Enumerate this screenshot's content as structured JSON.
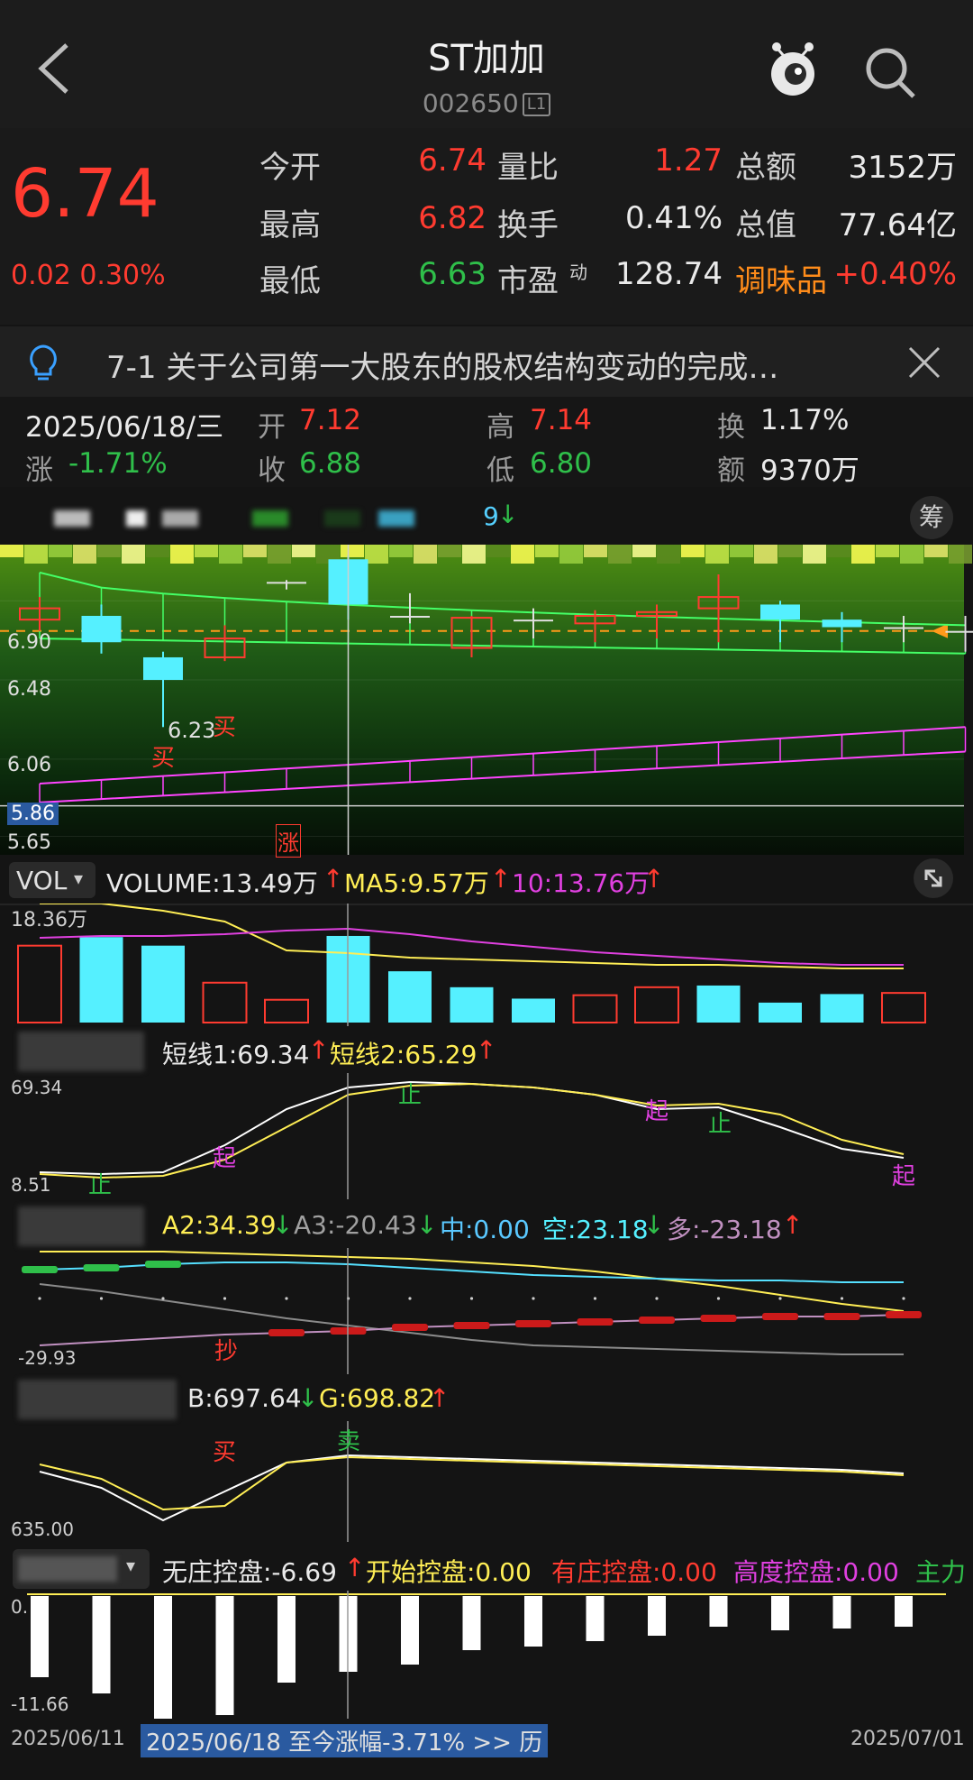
{
  "header": {
    "title": "ST加加",
    "code": "002650",
    "level_badge": "L1"
  },
  "quote": {
    "price": "6.74",
    "change": "0.02",
    "change_pct": "0.30%",
    "fields": [
      {
        "label": "今开",
        "value": "6.74",
        "color": "red"
      },
      {
        "label": "量比",
        "value": "1.27",
        "color": "red"
      },
      {
        "label": "总额",
        "value": "3152万",
        "color": "white"
      },
      {
        "label": "最高",
        "value": "6.82",
        "color": "red"
      },
      {
        "label": "换手",
        "value": "0.41%",
        "color": "white"
      },
      {
        "label": "总值",
        "value": "77.64亿",
        "color": "white"
      },
      {
        "label": "最低",
        "value": "6.63",
        "color": "green"
      },
      {
        "label": "市盈",
        "value": "128.74",
        "color": "white"
      },
      {
        "label": "调味品",
        "value": "+0.40%",
        "color": "red"
      }
    ],
    "pe_superscript": "动"
  },
  "notice": {
    "text": "7-1 关于公司第一大股东的股权结构变动的完成…"
  },
  "day_info": {
    "date": "2025/06/18/三",
    "open_label": "开",
    "open": "7.12",
    "high_label": "高",
    "high": "7.14",
    "turnover_label": "换",
    "turnover": "1.17%",
    "chg_label": "涨",
    "chg": "-1.71%",
    "close_label": "收",
    "close": "6.88",
    "low_label": "低",
    "low": "6.80",
    "amount_label": "额",
    "amount": "9370万"
  },
  "kline": {
    "chip_button": "筹",
    "overlay_value": "9",
    "axis_labels": [
      "6.90",
      "6.48",
      "6.06",
      "5.86",
      "5.65"
    ],
    "annotations": [
      "买",
      "6.23",
      "买",
      "涨"
    ],
    "candles": [
      {
        "o": 6.8,
        "c": 6.86,
        "h": 6.92,
        "l": 6.74
      },
      {
        "o": 6.82,
        "c": 6.68,
        "h": 6.88,
        "l": 6.62
      },
      {
        "o": 6.6,
        "c": 6.48,
        "h": 6.63,
        "l": 6.23
      },
      {
        "o": 6.6,
        "c": 6.7,
        "h": 6.77,
        "l": 6.58
      },
      {
        "o": 7.0,
        "c": 7.0,
        "h": 7.01,
        "l": 6.96
      },
      {
        "o": 7.12,
        "c": 6.88,
        "h": 7.14,
        "l": 6.8
      },
      {
        "o": 6.82,
        "c": 6.82,
        "h": 6.94,
        "l": 6.78
      },
      {
        "o": 6.65,
        "c": 6.81,
        "h": 6.82,
        "l": 6.6
      },
      {
        "o": 6.8,
        "c": 6.8,
        "h": 6.86,
        "l": 6.7
      },
      {
        "o": 6.78,
        "c": 6.82,
        "h": 6.85,
        "l": 6.68
      },
      {
        "o": 6.82,
        "c": 6.84,
        "h": 6.88,
        "l": 6.7
      },
      {
        "o": 6.86,
        "c": 6.92,
        "h": 7.04,
        "l": 6.68
      },
      {
        "o": 6.88,
        "c": 6.8,
        "h": 6.9,
        "l": 6.68
      },
      {
        "o": 6.8,
        "c": 6.76,
        "h": 6.84,
        "l": 6.68
      },
      {
        "o": 6.76,
        "c": 6.76,
        "h": 6.82,
        "l": 6.68
      },
      {
        "o": 6.74,
        "c": 6.74,
        "h": 6.82,
        "l": 6.63
      }
    ]
  },
  "volume": {
    "selector": "VOL",
    "volume_label": "VOLUME:13.49万",
    "ma5_label": "MA5:9.57万",
    "ma10_label": "10:13.76万",
    "axis_top": "18.36万",
    "bars": [
      {
        "v": 13.5,
        "up": true
      },
      {
        "v": 15.0,
        "up": false
      },
      {
        "v": 13.5,
        "up": false
      },
      {
        "v": 7.0,
        "up": true
      },
      {
        "v": 4.0,
        "up": true
      },
      {
        "v": 15.2,
        "up": false
      },
      {
        "v": 9.0,
        "up": false
      },
      {
        "v": 6.2,
        "up": false
      },
      {
        "v": 4.2,
        "up": false
      },
      {
        "v": 4.8,
        "up": true
      },
      {
        "v": 6.2,
        "up": true
      },
      {
        "v": 6.5,
        "up": false
      },
      {
        "v": 3.5,
        "up": false
      },
      {
        "v": 5.0,
        "up": false
      },
      {
        "v": 5.2,
        "up": true
      }
    ]
  },
  "short_line": {
    "label1": "短线1:69.34",
    "label2": "短线2:65.29",
    "axis_top": "69.34",
    "axis_bottom": "8.51",
    "marks": [
      "止",
      "起",
      "止",
      "起",
      "止",
      "起"
    ]
  },
  "indicator_a": {
    "a2": "A2:34.39",
    "a3": "A3:-20.43",
    "zhong": "中:0.00",
    "kong": "空:23.18",
    "duo": "多:-23.18",
    "axis_bottom": "-29.93",
    "mark": "抄"
  },
  "indicator_bg": {
    "b": "B:697.64",
    "g": "G:698.82",
    "axis_bottom": "635.00",
    "marks": [
      "买",
      "卖"
    ]
  },
  "control": {
    "wz": "无庄控盘:-6.69",
    "ks": "开始控盘:0.00",
    "yz": "有庄控盘:0.00",
    "gd": "高度控盘:0.00",
    "zl": "主力",
    "axis_top": "0.",
    "axis_bottom": "-11.66"
  },
  "footer": {
    "start_date": "2025/06/11",
    "range_text": "2025/06/18 至今涨幅-3.71%  >> 历",
    "end_date": "2025/07/01"
  },
  "colors": {
    "up": "#ff3b30",
    "down": "#55f0ff",
    "green": "#2fbf4a",
    "yellow": "#ffee55",
    "magenta": "#e040e0"
  }
}
